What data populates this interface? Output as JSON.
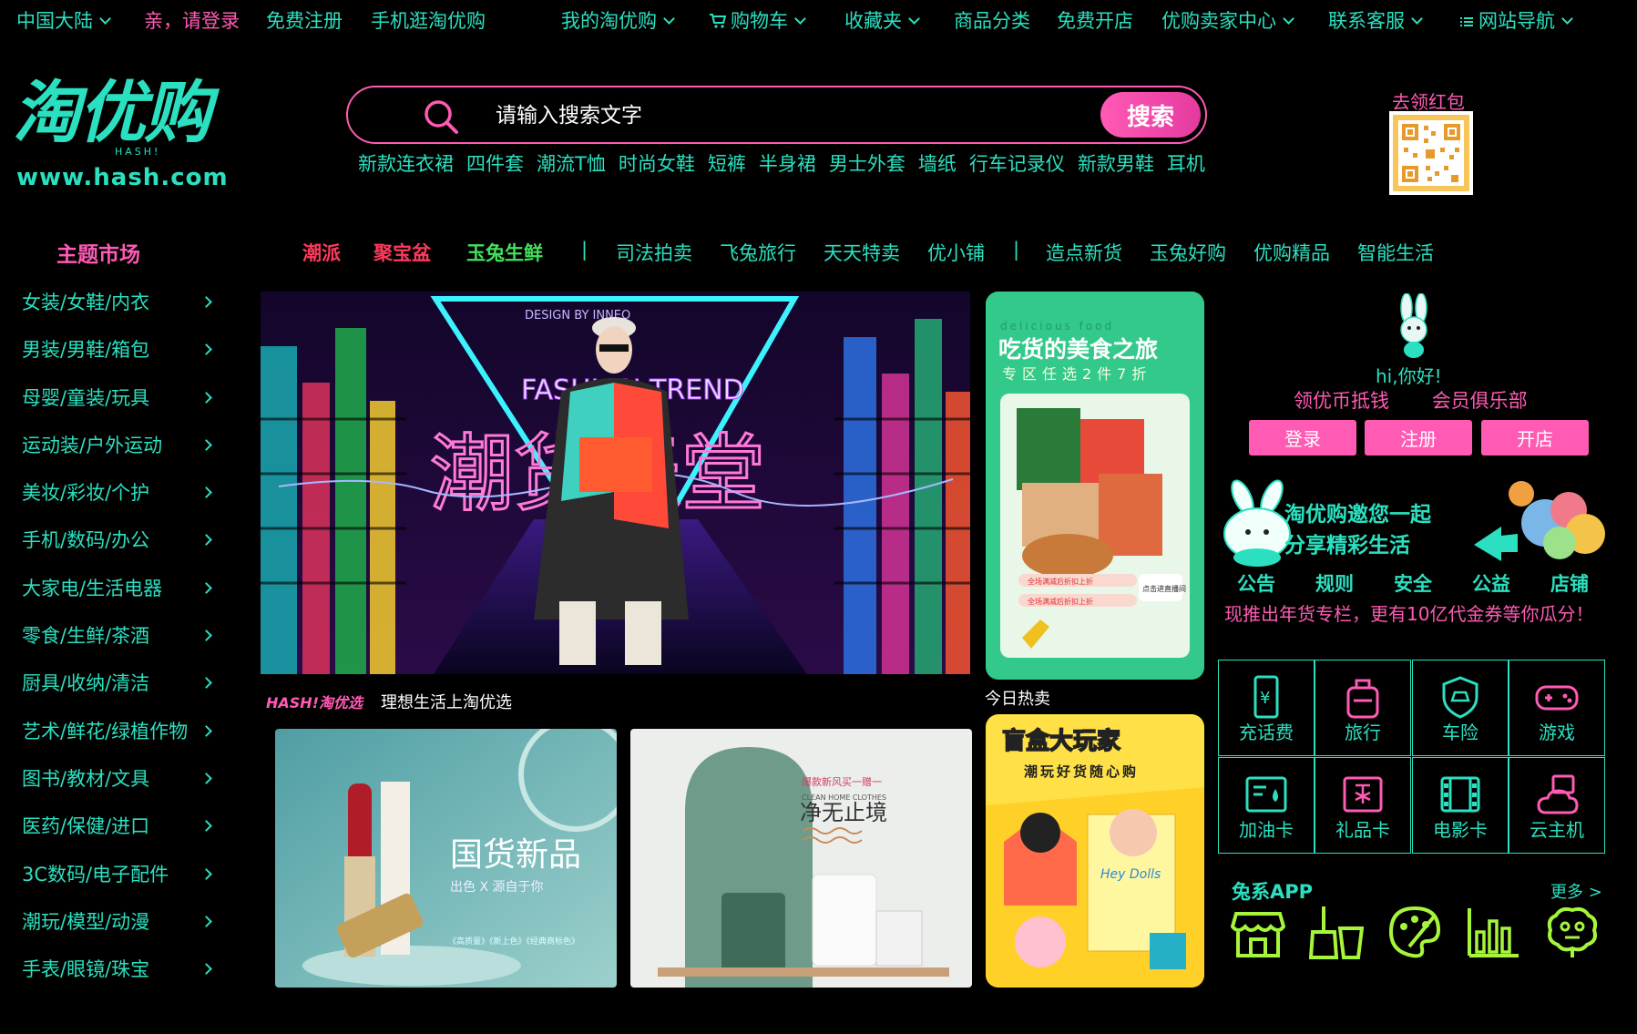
{
  "topnav": {
    "region": "中国大陆",
    "login": "亲，请登录",
    "register": "免费注册",
    "mobile": "手机逛淘优购",
    "my": "我的淘优购",
    "cart": "购物车",
    "favorites": "收藏夹",
    "categories": "商品分类",
    "open_shop": "免费开店",
    "seller_center": "优购卖家中心",
    "contact": "联系客服",
    "site_nav": "网站导航"
  },
  "logo": {
    "text": "淘优购",
    "sub": "HASH!",
    "url": "www.hash.com"
  },
  "search": {
    "placeholder": "请输入搜索文字",
    "button": "搜索",
    "hotwords": [
      "新款连衣裙",
      "四件套",
      "潮流T恤",
      "时尚女鞋",
      "短裤",
      "半身裙",
      "男士外套",
      "墙纸",
      "行车记录仪",
      "新款男鞋",
      "耳机"
    ]
  },
  "qr": {
    "label": "去领红包"
  },
  "theme_title": "主题市场",
  "catnav": [
    {
      "label": "潮派",
      "color": "#ff3a5c"
    },
    {
      "label": "聚宝盆",
      "color": "#ff3a5c"
    },
    {
      "label": "玉兔生鲜",
      "color": "#44e05c"
    },
    {
      "label": "|",
      "color": "#2be0c0"
    },
    {
      "label": "司法拍卖",
      "color": "#2be0c0"
    },
    {
      "label": "飞兔旅行",
      "color": "#2be0c0"
    },
    {
      "label": "天天特卖",
      "color": "#2be0c0"
    },
    {
      "label": "优小铺",
      "color": "#2be0c0"
    },
    {
      "label": "|",
      "color": "#2be0c0"
    },
    {
      "label": "造点新货",
      "color": "#2be0c0"
    },
    {
      "label": "玉兔好购",
      "color": "#2be0c0"
    },
    {
      "label": "优购精品",
      "color": "#2be0c0"
    },
    {
      "label": "智能生活",
      "color": "#2be0c0"
    }
  ],
  "sidebar": [
    "女装/女鞋/内衣",
    "男装/男鞋/箱包",
    "母婴/童装/玩具",
    "运动装/户外运动",
    "美妆/彩妆/个护",
    "手机/数码/办公",
    "大家电/生活电器",
    "零食/生鲜/茶酒",
    "厨具/收纳/清洁",
    "艺术/鲜花/绿植作物",
    "图书/教材/文具",
    "医药/保健/进口",
    "3C数码/电子配件",
    "潮玩/模型/动漫",
    "手表/眼镜/珠宝"
  ],
  "banner": {
    "design": "DESIGN BY INNEO",
    "fashion": "FASHION TREND",
    "headline": "潮货天堂"
  },
  "promo": {
    "top": "delicious food",
    "title": "吃货的美食之旅",
    "subtitle": "专区任选2件7折",
    "tag1": "全场满减后折扣上折",
    "tag2": "全场满减后折扣上折",
    "btn": "点击进直播间"
  },
  "slogan": {
    "brand": "HASH!淘优选",
    "text": "理想生活上淘优选"
  },
  "tile_left": {
    "title": "国货新品",
    "sub": "出色 X 源自于你",
    "foot": "《高质量》《新上色》《经典商标色》"
  },
  "tile_mid": {
    "top": "爆款新风买一赠一",
    "en": "CLEAN HOME CLOTHES",
    "title": "净无止境"
  },
  "today_hot": "今日热卖",
  "hot_tile": {
    "title": "盲盒大玩家",
    "sub": "潮玩好货随心购",
    "box": "Hey Dolls"
  },
  "user": {
    "greet": "hi,你好!",
    "link1": "领优币抵钱",
    "link2": "会员俱乐部",
    "login": "登录",
    "register": "注册",
    "shop": "开店"
  },
  "invite": {
    "line1": "淘优购邀您一起",
    "line2": "分享精彩生活"
  },
  "notice_tabs": [
    "公告",
    "规则",
    "安全",
    "公益",
    "店铺"
  ],
  "notice_text": "现推出年货专栏，更有10亿代金券等你瓜分！",
  "services": [
    {
      "label": "充话费",
      "icon": "phone-recharge-icon"
    },
    {
      "label": "旅行",
      "icon": "luggage-icon"
    },
    {
      "label": "车险",
      "icon": "car-insurance-icon"
    },
    {
      "label": "游戏",
      "icon": "gamepad-icon"
    },
    {
      "label": "加油卡",
      "icon": "fuel-card-icon"
    },
    {
      "label": "礼品卡",
      "icon": "gift-card-icon"
    },
    {
      "label": "电影卡",
      "icon": "film-icon"
    },
    {
      "label": "云主机",
      "icon": "cloud-host-icon"
    }
  ],
  "apps": {
    "title": "兔系APP",
    "more": "更多 >"
  },
  "colors": {
    "teal": "#2be0c0",
    "pink": "#ff5ab4",
    "green": "#a6f53a"
  }
}
